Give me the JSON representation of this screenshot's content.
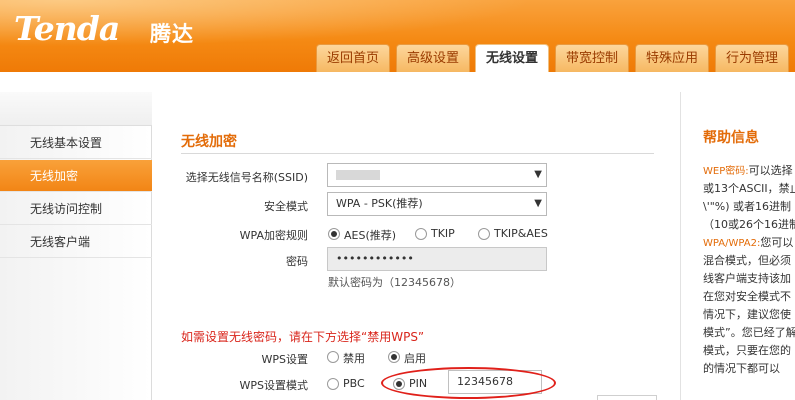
{
  "header": {
    "logo": "Tenda",
    "logo_cn": "腾达",
    "tabs": [
      {
        "label": "返回首页"
      },
      {
        "label": "高级设置"
      },
      {
        "label": "无线设置",
        "active": true
      },
      {
        "label": "带宽控制"
      },
      {
        "label": "特殊应用"
      },
      {
        "label": "行为管理"
      }
    ]
  },
  "sidebar": {
    "items": [
      {
        "label": "无线基本设置"
      },
      {
        "label": "无线加密",
        "active": true
      },
      {
        "label": "无线访问控制"
      },
      {
        "label": "无线客户端"
      }
    ]
  },
  "form": {
    "title": "无线加密",
    "ssid": {
      "label": "选择无线信号名称(SSID)",
      "value": ""
    },
    "security_mode": {
      "label": "安全模式",
      "value": "WPA - PSK(推荐)"
    },
    "wpa_rule": {
      "label": "WPA加密规则",
      "options": [
        "AES(推荐)",
        "TKIP",
        "TKIP&AES"
      ],
      "selected": "AES(推荐)"
    },
    "password": {
      "label": "密码",
      "value": "••••••••••••",
      "hint": "默认密码为（12345678）"
    },
    "wps_note": "如需设置无线密码，请在下方选择“禁用WPS”",
    "wps_setting": {
      "label": "WPS设置",
      "options": [
        "禁用",
        "启用"
      ],
      "selected": "启用"
    },
    "wps_mode": {
      "label": "WPS设置模式",
      "options": [
        "PBC",
        "PIN"
      ],
      "selected": "PIN",
      "pin_value": "12345678"
    }
  },
  "help": {
    "title": "帮助信息",
    "lines": [
      {
        "key": "WEP密码:",
        "text": "可以选择"
      },
      {
        "key": "",
        "text": "或13个ASCII，禁止"
      },
      {
        "key": "",
        "text": "\\'\"%) 或者16进制"
      },
      {
        "key": "",
        "text": "（10或26个16进制"
      },
      {
        "key": "WPA/WPA2:",
        "text": "您可以"
      },
      {
        "key": "",
        "text": "混合模式，但必须"
      },
      {
        "key": "",
        "text": "线客户端支持该加"
      },
      {
        "key": "",
        "text": "在您对安全模式不"
      },
      {
        "key": "",
        "text": "情况下，建议您使"
      },
      {
        "key": "",
        "text": "模式”。您已经了解"
      },
      {
        "key": "",
        "text": "模式，只要在您的"
      },
      {
        "key": "",
        "text": "的情况下都可以"
      }
    ]
  },
  "colors": {
    "accent": "#f28515",
    "title": "#e36c09",
    "warning": "#d9261c"
  }
}
